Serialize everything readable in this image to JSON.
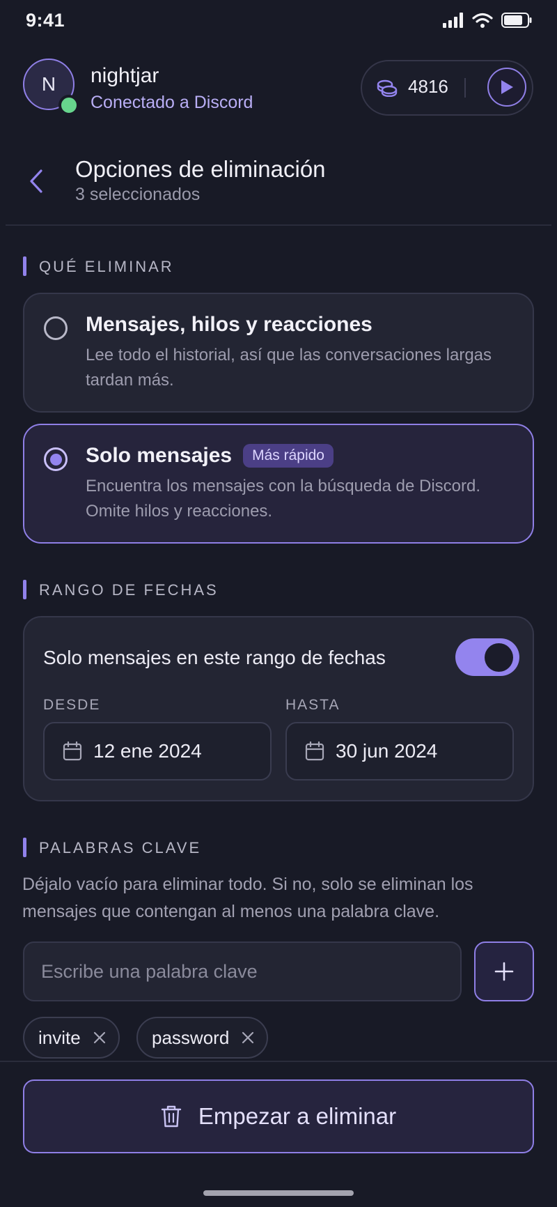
{
  "status_bar": {
    "time": "9:41",
    "icons": [
      "signal-icon",
      "wifi-icon",
      "battery-icon"
    ]
  },
  "profile": {
    "avatar_initial": "N",
    "username": "nightjar",
    "connection_status": "Conectado a Discord",
    "presence_color": "#67d58d"
  },
  "coins": {
    "icon": "coins-icon",
    "count": "4816",
    "play_icon": "play-icon"
  },
  "page": {
    "back_icon": "chevron-left-icon",
    "title": "Opciones de eliminación",
    "subtitle": "3 seleccionados"
  },
  "what_to_delete": {
    "section_title": "QUÉ ELIMINAR",
    "options": [
      {
        "title": "Mensajes, hilos y reacciones",
        "description": "Lee todo el historial, así que las conversaciones largas tardan más.",
        "selected": false
      },
      {
        "title": "Solo mensajes",
        "badge": "Más rápido",
        "description": "Encuentra los mensajes con la búsqueda de Discord. Omite hilos y reacciones.",
        "selected": true
      }
    ]
  },
  "date_range": {
    "section_title": "RANGO DE FECHAS",
    "toggle_label": "Solo mensajes en este rango de fechas",
    "toggle_on": true,
    "from_label": "DESDE",
    "from_value": "12 ene 2024",
    "to_label": "HASTA",
    "to_value": "30 jun 2024",
    "calendar_icon": "calendar-icon"
  },
  "keywords": {
    "section_title": "PALABRAS CLAVE",
    "help": "Déjalo vacío para eliminar todo. Si no, solo se eliminan los mensajes que contengan al menos una palabra clave.",
    "input_value": "",
    "input_placeholder": "Escribe una palabra clave",
    "add_icon": "plus-icon",
    "chips": [
      {
        "label": "invite",
        "remove_icon": "close-icon"
      },
      {
        "label": "password",
        "remove_icon": "close-icon"
      }
    ]
  },
  "primary_action": {
    "icon": "trash-icon",
    "label": "Empezar a eliminar"
  },
  "colors": {
    "background": "#181a26",
    "accent": "#9384ee",
    "card": "#232533"
  }
}
